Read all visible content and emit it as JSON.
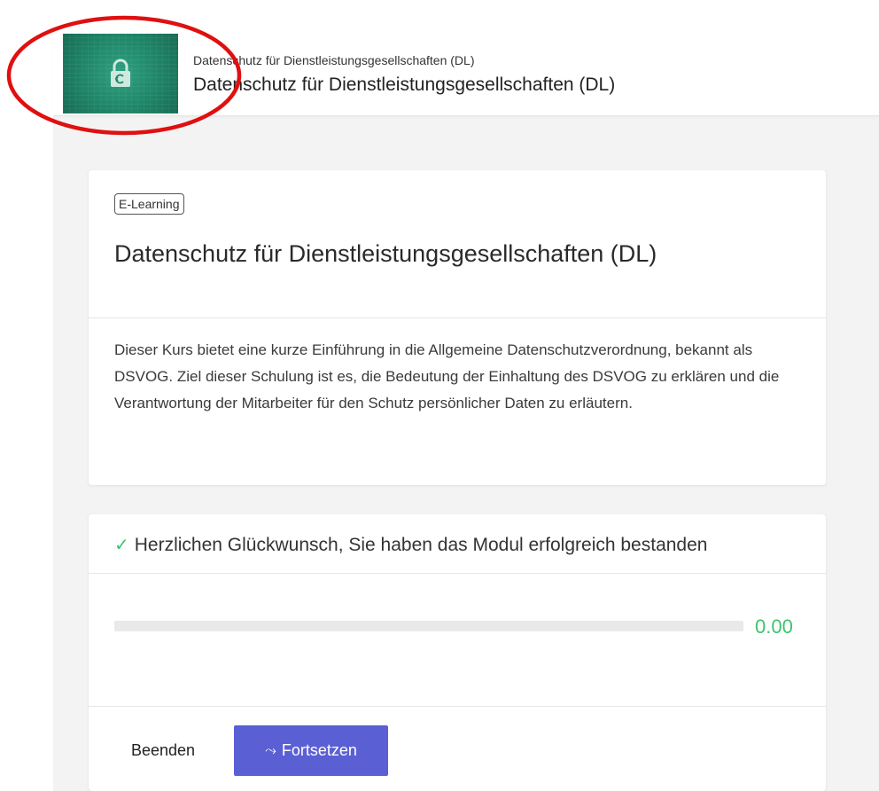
{
  "header": {
    "thumbnail_icon": "lock-icon",
    "subtitle": "Datenschutz für Dienstleistungsgesellschaften (DL)",
    "title": "Datenschutz für Dienstleistungsgesellschaften (DL)"
  },
  "course": {
    "tag": "E-Learning",
    "title": "Datenschutz für Dienstleistungsgesellschaften (DL)",
    "description": "Dieser Kurs bietet eine kurze Einführung in die Allgemeine Datenschutzverordnung, bekannt als DSVOG. Ziel dieser Schulung ist es, die Bedeutung der Einhaltung des DSVOG zu erklären und die Verantwortung der Mitarbeiter für den Schutz persönlicher Daten zu erläutern."
  },
  "result": {
    "message": "Herzlichen Glückwunsch, Sie haben das Modul erfolgreich bestanden",
    "progress_fraction": 0,
    "progress_value": "0.00"
  },
  "actions": {
    "end_label": "Beenden",
    "continue_label": "Fortsetzen",
    "continue_icon": "resume-icon"
  },
  "colors": {
    "accent": "#5b5fd4",
    "success": "#3cc46e",
    "annotation": "#e01010"
  }
}
